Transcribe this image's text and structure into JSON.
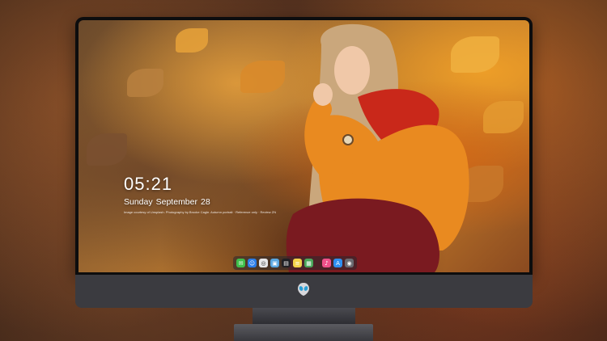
{
  "lock_screen": {
    "time": "05:21",
    "day": "Sunday",
    "month": "September",
    "date": "28",
    "quote": "Image courtesy of Unsplash. Photography by Brooke Cagle. Autumn portrait · Reference only · Review ZN"
  },
  "dock": {
    "apps": [
      {
        "name": "messages-icon",
        "color": "#3fbf4a",
        "glyph": "✉"
      },
      {
        "name": "finder-icon",
        "color": "#2b7de9",
        "glyph": "☺"
      },
      {
        "name": "safari-icon",
        "color": "#e8e8ea",
        "glyph": "◎"
      },
      {
        "name": "photos-icon",
        "color": "#5aa7e0",
        "glyph": "▣"
      },
      {
        "name": "clapper-icon",
        "color": "#202024",
        "glyph": "▤"
      },
      {
        "name": "notes-icon",
        "color": "#f4d24a",
        "glyph": "≡"
      },
      {
        "name": "preview-icon",
        "color": "#4aa65a",
        "glyph": "▦"
      },
      {
        "name": "music-icon",
        "color": "#f0508a",
        "glyph": "♪"
      },
      {
        "name": "appstore-icon",
        "color": "#2f8ff0",
        "glyph": "A"
      },
      {
        "name": "camera-icon",
        "color": "#6a6a70",
        "glyph": "◉"
      }
    ]
  },
  "colors": {
    "bezel": "#0d0d0e",
    "chin": "#3b3b40",
    "accent": "#d4781e"
  }
}
